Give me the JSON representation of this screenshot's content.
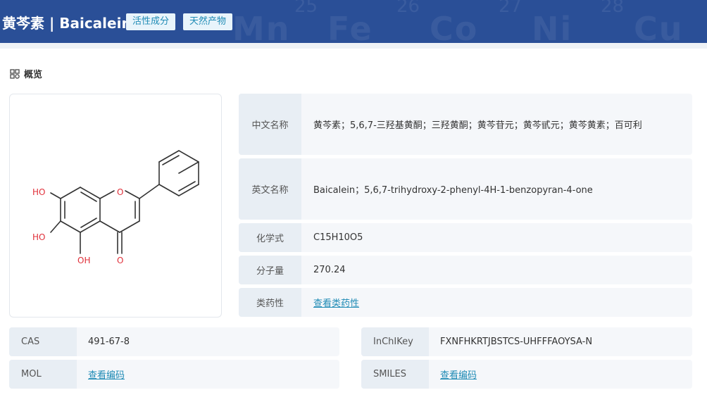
{
  "header": {
    "title": "黄芩素 | Baicalein",
    "tags": [
      "活性成分",
      "天然产物"
    ],
    "bg_elements": [
      "Mn",
      "Fe",
      "Co",
      "Ni",
      "Cu"
    ],
    "bg_numbers": [
      "25",
      "26",
      "27",
      "28"
    ]
  },
  "section": {
    "overview_label": "概览"
  },
  "structure": {
    "atom_labels": [
      "HO",
      "HO",
      "OH",
      "O",
      "O"
    ]
  },
  "info": {
    "cn_name": {
      "label": "中文名称",
      "value": "黄芩素；5,6,7-三羟基黄酮；三羟黄酮；黄芩苷元；黄芩甙元；黄芩黄素；百可利"
    },
    "en_name": {
      "label": "英文名称",
      "value": "Baicalein；5,6,7-trihydroxy-2-phenyl-4H-1-benzopyran-4-one"
    },
    "formula": {
      "label": "化学式",
      "value": "C15H10O5"
    },
    "mw": {
      "label": "分子量",
      "value": "270.24"
    },
    "druglike": {
      "label": "类药性",
      "value": "查看类药性"
    }
  },
  "identifiers": {
    "cas": {
      "label": "CAS",
      "value": "491-67-8"
    },
    "inchikey": {
      "label": "InChIKey",
      "value": "FXNFHKRTJBSTCS-UHFFFAOYSA-N"
    },
    "mol": {
      "label": "MOL",
      "value": "查看编码"
    },
    "smiles": {
      "label": "SMILES",
      "value": "查看编码"
    }
  },
  "colors": {
    "header_bg": "#2a4f97",
    "accent": "#1f8bb5",
    "heteroatom": "#e0303a"
  }
}
